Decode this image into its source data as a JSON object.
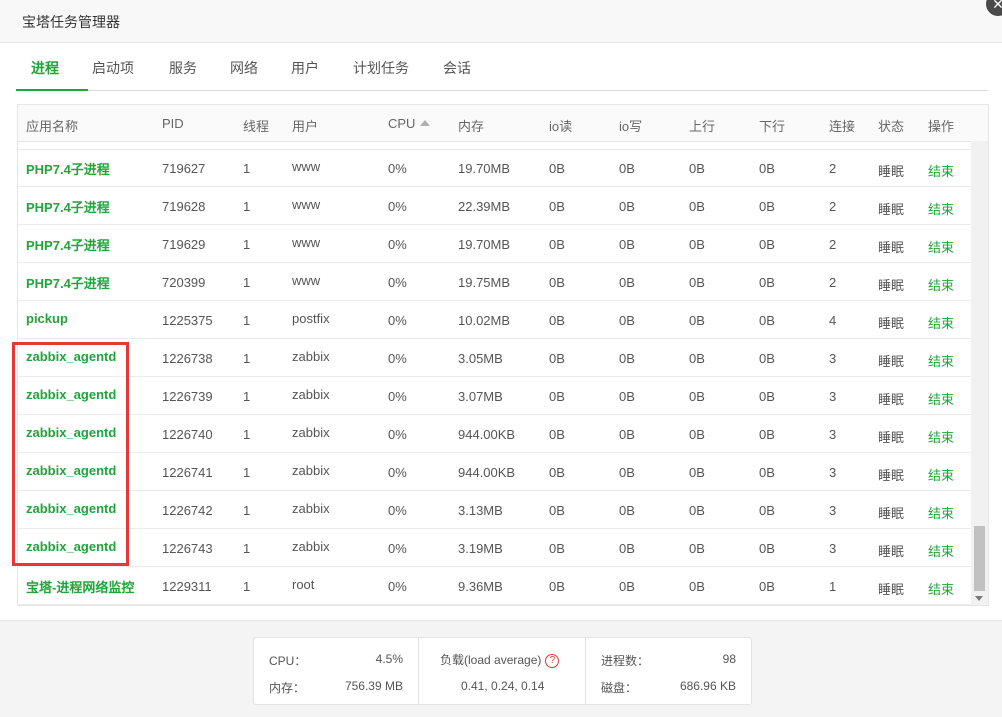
{
  "window": {
    "title": "宝塔任务管理器"
  },
  "tabs": [
    {
      "label": "进程"
    },
    {
      "label": "启动项"
    },
    {
      "label": "服务"
    },
    {
      "label": "网络"
    },
    {
      "label": "用户"
    },
    {
      "label": "计划任务"
    },
    {
      "label": "会话"
    }
  ],
  "active_tab": "进程",
  "columns": [
    "应用名称",
    "PID",
    "线程",
    "用户",
    "CPU",
    "内存",
    "io读",
    "io写",
    "上行",
    "下行",
    "连接",
    "状态",
    "操作"
  ],
  "sort": {
    "column": "CPU",
    "direction": "asc"
  },
  "rows": [
    {
      "name": "PHP7.4子进程",
      "pid": "719627",
      "threads": "1",
      "user": "www",
      "cpu": "0%",
      "mem": "19.70MB",
      "io_read": "0B",
      "io_write": "0B",
      "up": "0B",
      "down": "0B",
      "conn": "2",
      "status": "睡眠",
      "action": "结束"
    },
    {
      "name": "PHP7.4子进程",
      "pid": "719628",
      "threads": "1",
      "user": "www",
      "cpu": "0%",
      "mem": "22.39MB",
      "io_read": "0B",
      "io_write": "0B",
      "up": "0B",
      "down": "0B",
      "conn": "2",
      "status": "睡眠",
      "action": "结束"
    },
    {
      "name": "PHP7.4子进程",
      "pid": "719629",
      "threads": "1",
      "user": "www",
      "cpu": "0%",
      "mem": "19.70MB",
      "io_read": "0B",
      "io_write": "0B",
      "up": "0B",
      "down": "0B",
      "conn": "2",
      "status": "睡眠",
      "action": "结束"
    },
    {
      "name": "PHP7.4子进程",
      "pid": "720399",
      "threads": "1",
      "user": "www",
      "cpu": "0%",
      "mem": "19.75MB",
      "io_read": "0B",
      "io_write": "0B",
      "up": "0B",
      "down": "0B",
      "conn": "2",
      "status": "睡眠",
      "action": "结束"
    },
    {
      "name": "pickup",
      "pid": "1225375",
      "threads": "1",
      "user": "postfix",
      "cpu": "0%",
      "mem": "10.02MB",
      "io_read": "0B",
      "io_write": "0B",
      "up": "0B",
      "down": "0B",
      "conn": "4",
      "status": "睡眠",
      "action": "结束"
    },
    {
      "name": "zabbix_agentd",
      "pid": "1226738",
      "threads": "1",
      "user": "zabbix",
      "cpu": "0%",
      "mem": "3.05MB",
      "io_read": "0B",
      "io_write": "0B",
      "up": "0B",
      "down": "0B",
      "conn": "3",
      "status": "睡眠",
      "action": "结束"
    },
    {
      "name": "zabbix_agentd",
      "pid": "1226739",
      "threads": "1",
      "user": "zabbix",
      "cpu": "0%",
      "mem": "3.07MB",
      "io_read": "0B",
      "io_write": "0B",
      "up": "0B",
      "down": "0B",
      "conn": "3",
      "status": "睡眠",
      "action": "结束"
    },
    {
      "name": "zabbix_agentd",
      "pid": "1226740",
      "threads": "1",
      "user": "zabbix",
      "cpu": "0%",
      "mem": "944.00KB",
      "io_read": "0B",
      "io_write": "0B",
      "up": "0B",
      "down": "0B",
      "conn": "3",
      "status": "睡眠",
      "action": "结束"
    },
    {
      "name": "zabbix_agentd",
      "pid": "1226741",
      "threads": "1",
      "user": "zabbix",
      "cpu": "0%",
      "mem": "944.00KB",
      "io_read": "0B",
      "io_write": "0B",
      "up": "0B",
      "down": "0B",
      "conn": "3",
      "status": "睡眠",
      "action": "结束"
    },
    {
      "name": "zabbix_agentd",
      "pid": "1226742",
      "threads": "1",
      "user": "zabbix",
      "cpu": "0%",
      "mem": "3.13MB",
      "io_read": "0B",
      "io_write": "0B",
      "up": "0B",
      "down": "0B",
      "conn": "3",
      "status": "睡眠",
      "action": "结束"
    },
    {
      "name": "zabbix_agentd",
      "pid": "1226743",
      "threads": "1",
      "user": "zabbix",
      "cpu": "0%",
      "mem": "3.19MB",
      "io_read": "0B",
      "io_write": "0B",
      "up": "0B",
      "down": "0B",
      "conn": "3",
      "status": "睡眠",
      "action": "结束"
    },
    {
      "name": "宝塔-进程网络监控",
      "pid": "1229311",
      "threads": "1",
      "user": "root",
      "cpu": "0%",
      "mem": "9.36MB",
      "io_read": "0B",
      "io_write": "0B",
      "up": "0B",
      "down": "0B",
      "conn": "1",
      "status": "睡眠",
      "action": "结束"
    }
  ],
  "summary": {
    "cpu_label": "CPU：",
    "cpu_value": "4.5%",
    "mem_label": "内存：",
    "mem_value": "756.39 MB",
    "load_label": "负载(load average)",
    "load_help_icon": "question-circle-icon",
    "load_value": "0.41, 0.24, 0.14",
    "proc_label": "进程数：",
    "proc_value": "98",
    "disk_label": "磁盘：",
    "disk_value": "686.96 KB"
  },
  "colors": {
    "accent": "#20a53a",
    "highlight": "#e53935"
  }
}
